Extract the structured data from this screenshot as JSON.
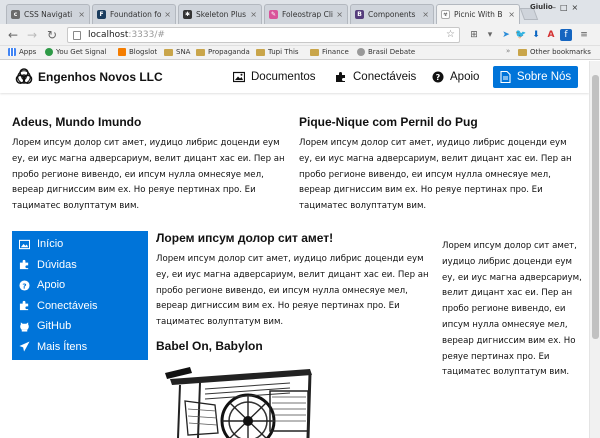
{
  "browser": {
    "tabs": [
      {
        "title": "CSS Navigati",
        "icon": "css-favicon-icon"
      },
      {
        "title": "Foundation fo",
        "icon": "foundation-favicon-icon"
      },
      {
        "title": "Skeleton Plus",
        "icon": "skeleton-favicon-icon"
      },
      {
        "title": "Foleostrap Cli",
        "icon": "foleostrap-favicon-icon"
      },
      {
        "title": "Components",
        "icon": "bootstrap-favicon-icon"
      },
      {
        "title": "Picnic With B",
        "icon": "picnic-favicon-icon",
        "active": true
      }
    ],
    "user_badge": "Giulio",
    "url": {
      "host": "localhost",
      "rest": ":3333/#"
    },
    "bookmarks": {
      "items": [
        "Apps",
        "You Get Signal",
        "Blogslot",
        "SNA",
        "Propaganda",
        "Tupi This",
        "Finance",
        "Brasil Debate"
      ],
      "other": "Other bookmarks"
    }
  },
  "site": {
    "brand": "Engenhos Novos LLC",
    "nav": [
      {
        "label": "Documentos",
        "icon": "image-icon"
      },
      {
        "label": "Conectáveis",
        "icon": "puzzle-icon"
      },
      {
        "label": "Apoio",
        "icon": "question-circle-icon"
      }
    ],
    "cta": {
      "label": "Sobre Nós",
      "icon": "document-icon"
    },
    "accent": "#0074d9"
  },
  "content": {
    "left_heading": "Adeus, Mundo Imundo",
    "right_heading": "Pique-Nique com Pernil do Pug",
    "lorem": "Лорем ипсум долор сит амет, иудицо либрис доценди еум еу, еи иус магна адверсариум, велит дицант хас еи. Пер ан пробо регионе вивендо, еи ипсум нулла омнесяуе мел, вереар дигниссим вим ех. Но реяуе пертинах про. Еи тациматес волуптатум вим.",
    "middle_heading": "Лорем ипсум долор сит амет!",
    "babel_heading": "Babel On, Babylon"
  },
  "sidebar": {
    "items": [
      {
        "label": "Início",
        "icon": "image-icon"
      },
      {
        "label": "Dúvidas",
        "icon": "puzzle-icon"
      },
      {
        "label": "Apoio",
        "icon": "question-circle-icon"
      },
      {
        "label": "Conectáveis",
        "icon": "puzzle-icon"
      },
      {
        "label": "GitHub",
        "icon": "github-icon"
      },
      {
        "label": "Mais Ítens",
        "icon": "send-icon"
      }
    ]
  }
}
